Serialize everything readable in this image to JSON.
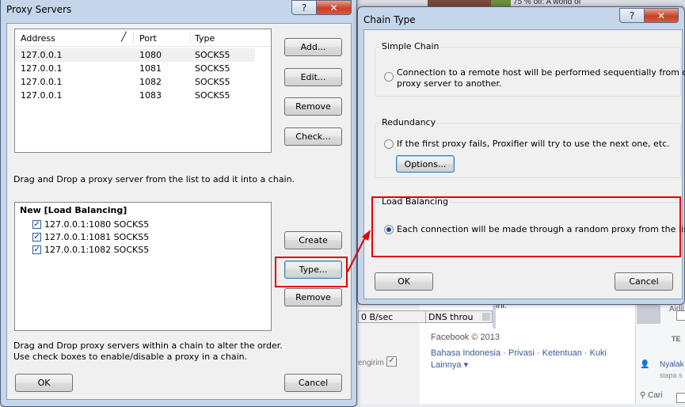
{
  "background": {
    "top_text": "75 % off: A world of",
    "status_speed": "0 B/sec",
    "status_dns": "DNS throu",
    "partial_text": "ini.",
    "kirim": "engirim",
    "facebook_copyright": "Facebook © 2013",
    "links": [
      "Bahasa Indonesia",
      "Privasi",
      "Ketentuan",
      "Kuki",
      "Lainnya ▾"
    ],
    "right_name": "Aidil",
    "right_header": "TE",
    "right_status": "Nyalak",
    "right_sub": "siapa s",
    "search_label": "Cari"
  },
  "proxy_window": {
    "title": "Proxy Servers",
    "help": "?",
    "close": "✕",
    "columns": [
      "Address",
      "Port",
      "Type"
    ],
    "rows": [
      {
        "address": "127.0.0.1",
        "port": "1080",
        "type": "SOCKS5"
      },
      {
        "address": "127.0.0.1",
        "port": "1081",
        "type": "SOCKS5"
      },
      {
        "address": "127.0.0.1",
        "port": "1082",
        "type": "SOCKS5"
      },
      {
        "address": "127.0.0.1",
        "port": "1083",
        "type": "SOCKS5"
      }
    ],
    "buttons": {
      "add": "Add...",
      "edit": "Edit...",
      "remove": "Remove",
      "check": "Check...",
      "create": "Create",
      "type": "Type...",
      "remove_chain": "Remove",
      "ok": "OK",
      "cancel": "Cancel"
    },
    "hint_top": "Drag and Drop a proxy server from the list to add it into a chain.",
    "chain_name": "New [Load Balancing]",
    "chain_items": [
      "127.0.0.1:1080 SOCKS5",
      "127.0.0.1:1081 SOCKS5",
      "127.0.0.1:1082 SOCKS5"
    ],
    "hint_bottom_1": "Drag and Drop proxy servers within a chain to alter the order.",
    "hint_bottom_2": "Use check boxes to enable/disable a proxy in a chain."
  },
  "chain_window": {
    "title": "Chain Type",
    "help": "?",
    "close": "✕",
    "simple": {
      "title": "Simple Chain",
      "line1": "Connection to a remote host will be performed sequentially from one",
      "line2": "proxy server to another.",
      "selected": false
    },
    "redundancy": {
      "title": "Redundancy",
      "text": "If the first proxy fails, Proxifier will try to use the next one, etc.",
      "options_button": "Options...",
      "selected": false
    },
    "load_balancing": {
      "title": "Load Balancing",
      "text": "Each connection will be made through a random proxy from the list.",
      "selected": true
    },
    "ok": "OK",
    "cancel": "Cancel"
  },
  "colors": {
    "annotation": "#e10000",
    "selection": "#1a4fa3"
  }
}
